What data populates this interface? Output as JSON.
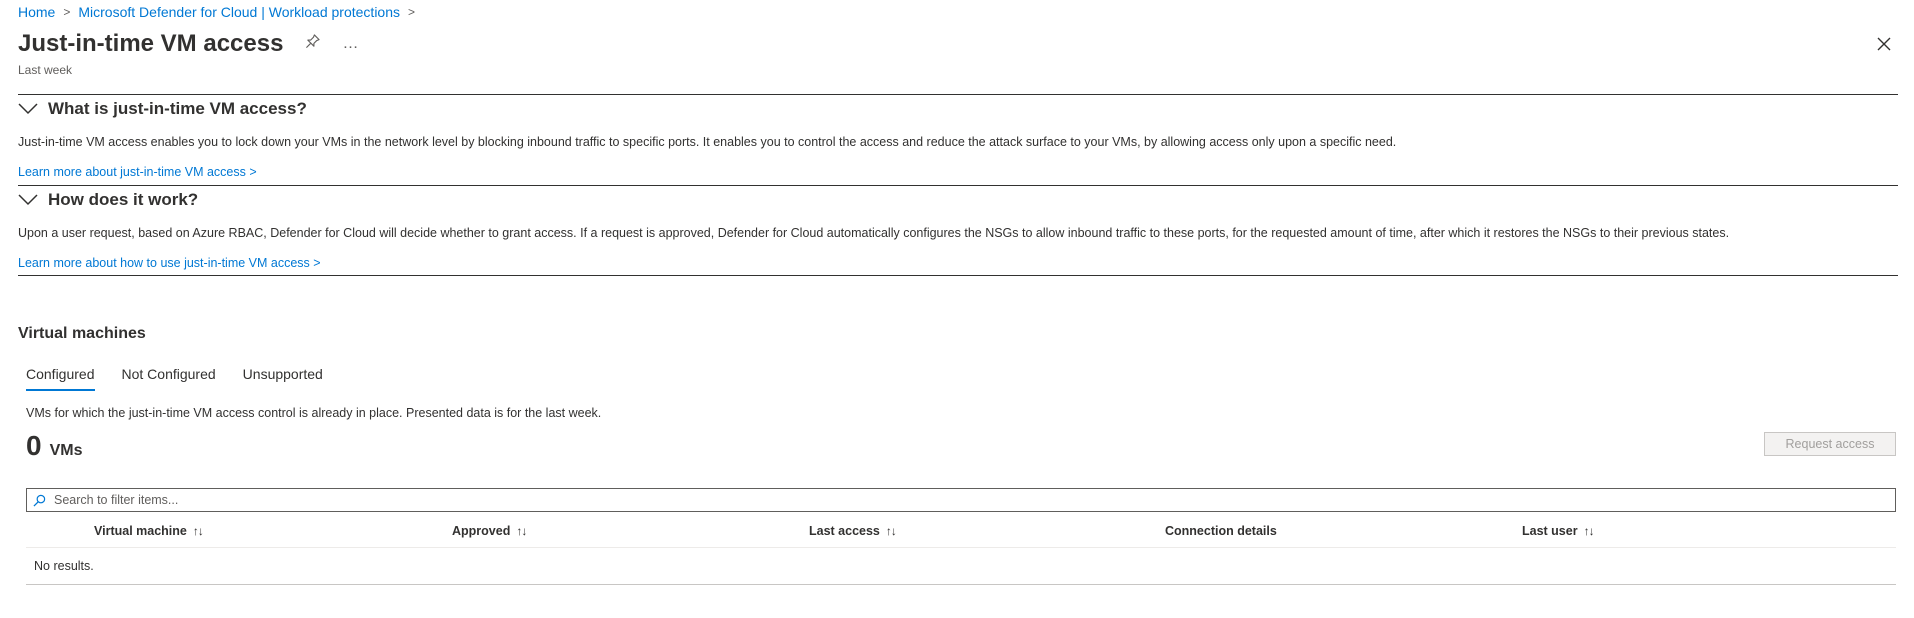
{
  "breadcrumb": {
    "items": [
      "Home",
      "Microsoft Defender for Cloud | Workload protections"
    ],
    "separator": ">"
  },
  "header": {
    "title": "Just-in-time VM access",
    "subtitle": "Last week",
    "pin_icon": "pin-icon",
    "more_icon": "…"
  },
  "sections": [
    {
      "title": "What is just-in-time VM access?",
      "body": "Just-in-time VM access enables you to lock down your VMs in the network level by blocking inbound traffic to specific ports. It enables you to control the access and reduce the attack surface to your VMs, by allowing access only upon a specific need.",
      "link": "Learn more about just-in-time VM access >"
    },
    {
      "title": "How does it work?",
      "body": "Upon a user request, based on Azure RBAC, Defender for Cloud will decide whether to grant access. If a request is approved, Defender for Cloud automatically configures the NSGs to allow inbound traffic to these ports, for the requested amount of time, after which it restores the NSGs to their previous states.",
      "link": "Learn more about how to use just-in-time VM access >"
    }
  ],
  "vms": {
    "heading": "Virtual machines",
    "tabs": [
      "Configured",
      "Not Configured",
      "Unsupported"
    ],
    "active_tab": "Configured",
    "description": "VMs for which the just-in-time VM access control is already in place. Presented data is for the last week.",
    "count": "0",
    "count_unit": "VMs",
    "request_button": "Request access",
    "search_placeholder": "Search to filter items...",
    "table": {
      "columns": [
        "Virtual machine",
        "Approved",
        "Last access",
        "Connection details",
        "Last user"
      ],
      "sort_glyph": "↑↓",
      "empty_text": "No results."
    }
  },
  "colors": {
    "accent": "#0078d4",
    "text": "#323130",
    "muted": "#605e5c"
  }
}
